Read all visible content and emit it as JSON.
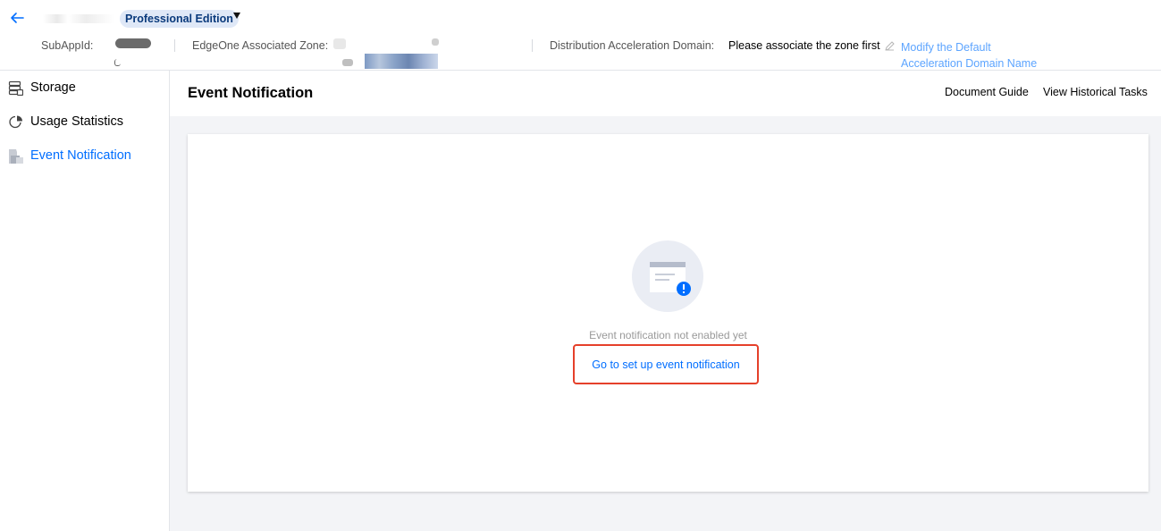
{
  "header": {
    "app_name": "",
    "edition": "Professional Edition",
    "subappid_label": "SubAppId:",
    "zone_label": "EdgeOne Associated Zone:",
    "domain_label": "Distribution Acceleration Domain:",
    "domain_value": "Please associate the zone first",
    "modify_link": "Modify the Default Acceleration Domain Name"
  },
  "sidebar": {
    "items": [
      {
        "label": "Storage",
        "icon": "storage-icon",
        "active": false
      },
      {
        "label": "Usage Statistics",
        "icon": "pie-chart-icon",
        "active": false
      },
      {
        "label": "Event Notification",
        "icon": "event-notification-icon",
        "active": true
      }
    ]
  },
  "main": {
    "title": "Event Notification",
    "links": {
      "doc_guide": "Document Guide",
      "history_tasks": "View Historical Tasks"
    },
    "empty_state": {
      "message": "Event notification not enabled yet",
      "action": "Go to set up event notification"
    }
  },
  "colors": {
    "accent": "#006eff",
    "highlight_border": "#e5402a",
    "edition_bg": "#dfe8f7",
    "page_bg": "#f3f4f7"
  }
}
